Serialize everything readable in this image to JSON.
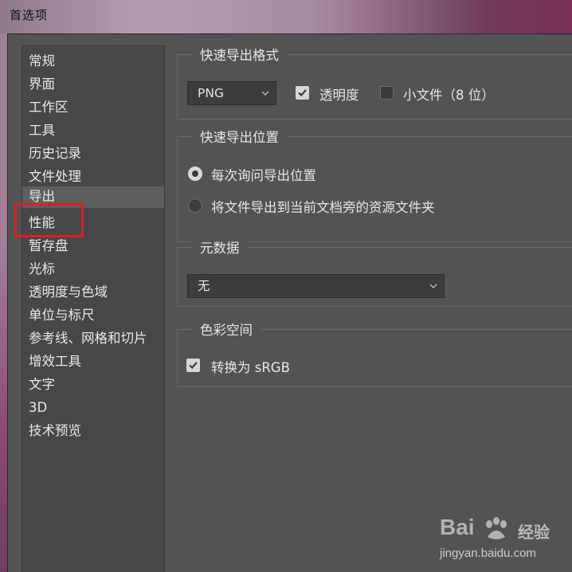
{
  "window": {
    "title": "首选项"
  },
  "sidebar": {
    "items": [
      {
        "label": "常规"
      },
      {
        "label": "界面"
      },
      {
        "label": "工作区"
      },
      {
        "label": "工具"
      },
      {
        "label": "历史记录"
      },
      {
        "label": "文件处理"
      },
      {
        "label": "导出",
        "selected": true
      },
      {
        "label": "性能",
        "highlighted": true
      },
      {
        "label": "暂存盘"
      },
      {
        "label": "光标"
      },
      {
        "label": "透明度与色域"
      },
      {
        "label": "单位与标尺"
      },
      {
        "label": "参考线、网格和切片"
      },
      {
        "label": "增效工具"
      },
      {
        "label": "文字"
      },
      {
        "label": "3D"
      },
      {
        "label": "技术预览"
      }
    ],
    "highlight_color": "#d8202a"
  },
  "quick_export_format": {
    "title": "快速导出格式",
    "format_value": "PNG",
    "transparency_label": "透明度",
    "transparency_checked": true,
    "small_file_label": "小文件（8 位）",
    "small_file_checked": false
  },
  "quick_export_location": {
    "title": "快速导出位置",
    "option_ask": "每次询问导出位置",
    "option_ask_selected": true,
    "option_assets": "将文件导出到当前文档旁的资源文件夹",
    "option_assets_selected": false
  },
  "metadata": {
    "title": "元数据",
    "value": "无"
  },
  "color_space": {
    "title": "色彩空间",
    "convert_label": "转换为 sRGB",
    "convert_checked": true
  },
  "watermark": {
    "brand": "Bai",
    "suffix": "经验",
    "url": "jingyan.baidu.com"
  },
  "colors": {
    "panel_bg": "#535353",
    "sidebar_bg": "#474747",
    "selected_bg": "#5e5e5e",
    "text": "#e6e6e6"
  }
}
